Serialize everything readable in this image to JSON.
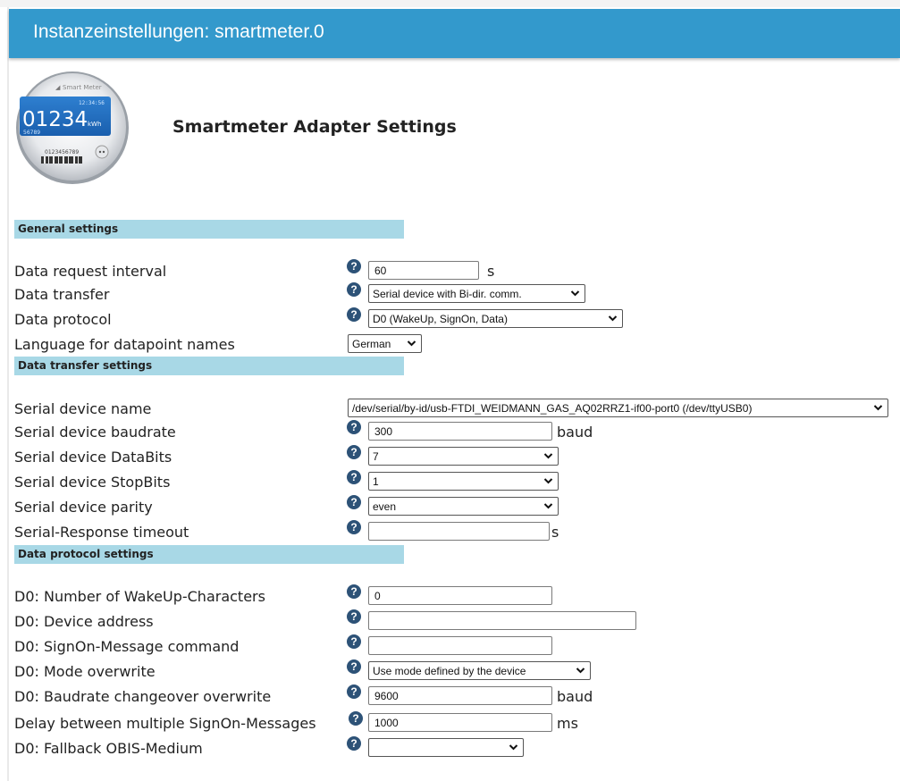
{
  "window_title": "Instanzeinstellungen: smartmeter.0",
  "logo": {
    "brand": "Smart Meter",
    "time": "12:34:56",
    "reading": "01234",
    "unit": "kWh",
    "sub": "56789",
    "serial": "0123456789",
    "icon": "smart-meter-image"
  },
  "page_title": "Smartmeter Adapter Settings",
  "sections": {
    "general": "General settings",
    "transfer": "Data transfer settings",
    "protocol": "Data protocol settings"
  },
  "general": {
    "interval": {
      "label": "Data request interval",
      "value": "60",
      "unit": "s"
    },
    "transfer": {
      "label": "Data transfer",
      "value": "Serial device with Bi-dir. comm."
    },
    "protocol": {
      "label": "Data protocol",
      "value": "D0 (WakeUp, SignOn, Data)"
    },
    "language": {
      "label": "Language for datapoint names",
      "value": "German"
    }
  },
  "transfer": {
    "device": {
      "label": "Serial device name",
      "value": "/dev/serial/by-id/usb-FTDI_WEIDMANN_GAS_AQ02RRZ1-if00-port0 (/dev/ttyUSB0)"
    },
    "baudrate": {
      "label": "Serial device baudrate",
      "value": "300",
      "unit": "baud"
    },
    "databits": {
      "label": "Serial device DataBits",
      "value": "7"
    },
    "stopbits": {
      "label": "Serial device StopBits",
      "value": "1"
    },
    "parity": {
      "label": "Serial device parity",
      "value": "even"
    },
    "timeout": {
      "label": "Serial-Response timeout",
      "value": "",
      "unit": "s"
    }
  },
  "protocol": {
    "wakeup": {
      "label": "D0: Number of WakeUp-Characters",
      "value": "0"
    },
    "address": {
      "label": "D0: Device address",
      "value": ""
    },
    "signon": {
      "label": "D0: SignOn-Message command",
      "value": ""
    },
    "mode": {
      "label": "D0: Mode overwrite",
      "value": "Use mode defined by the device"
    },
    "baud_over": {
      "label": "D0: Baudrate changeover overwrite",
      "value": "9600",
      "unit": "baud"
    },
    "delay": {
      "label": "Delay between multiple SignOn-Messages",
      "value": "1000",
      "unit": "ms"
    },
    "fallback": {
      "label": "D0: Fallback OBIS-Medium",
      "value": ""
    }
  },
  "help_glyph": "?",
  "colors": {
    "header": "#3399cc",
    "section": "#a8d8e6",
    "help": "#2d5277"
  }
}
